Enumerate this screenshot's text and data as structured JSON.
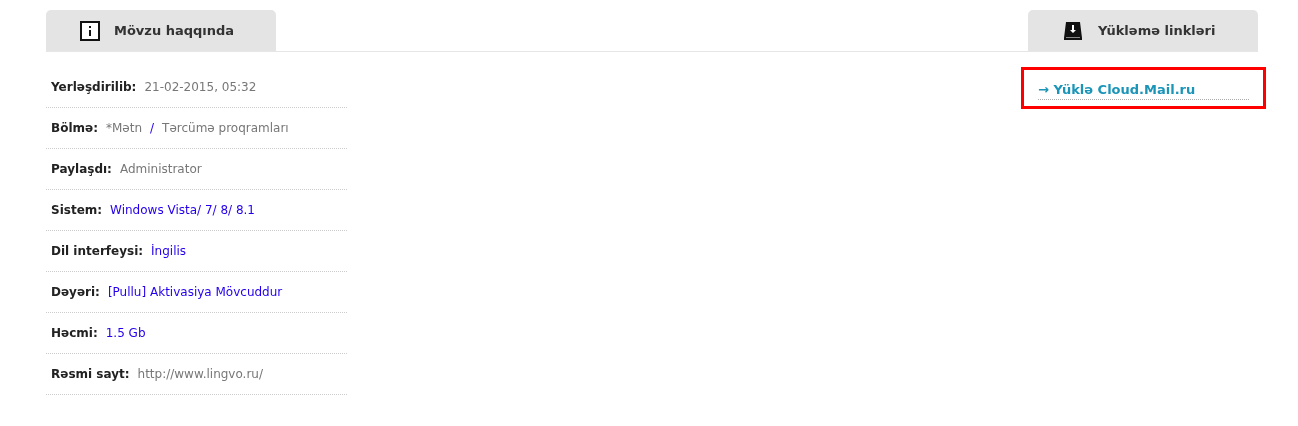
{
  "tabs": [
    {
      "label": "Mövzu haqqında",
      "kind": "info"
    },
    {
      "label": "Yükləmə linkləri",
      "kind": "download"
    }
  ],
  "details": [
    {
      "label": "Yerləşdirilib:",
      "value": [
        {
          "text": "21-02-2015, 05:32",
          "kind": "text"
        }
      ]
    },
    {
      "label": "Bölmə:",
      "value": [
        {
          "text": "*Mətn",
          "kind": "text"
        },
        {
          "text": "/",
          "kind": "link"
        },
        {
          "text": "Tərcümə proqramları",
          "kind": "text"
        }
      ]
    },
    {
      "label": "Paylaşdı:",
      "value": [
        {
          "text": "Administrator",
          "kind": "text"
        }
      ]
    },
    {
      "label": "Sistem:",
      "value": [
        {
          "text": "Windows Vista/ 7/ 8/ 8.1",
          "kind": "link"
        }
      ]
    },
    {
      "label": "Dil interfeysi:",
      "value": [
        {
          "text": "İngilis",
          "kind": "link"
        }
      ]
    },
    {
      "label": "Dəyəri:",
      "value": [
        {
          "text": "[Pullu] Aktivasiya Mövcuddur",
          "kind": "link"
        }
      ]
    },
    {
      "label": "Həcmi:",
      "value": [
        {
          "text": "1.5 Gb",
          "kind": "link"
        }
      ]
    },
    {
      "label": "Rəsmi sayt:",
      "value": [
        {
          "text": "http://www.lingvo.ru/",
          "kind": "text"
        }
      ]
    }
  ],
  "downloads": [
    {
      "text": "→ Yüklə Cloud.Mail.ru",
      "highlighted": true
    }
  ]
}
